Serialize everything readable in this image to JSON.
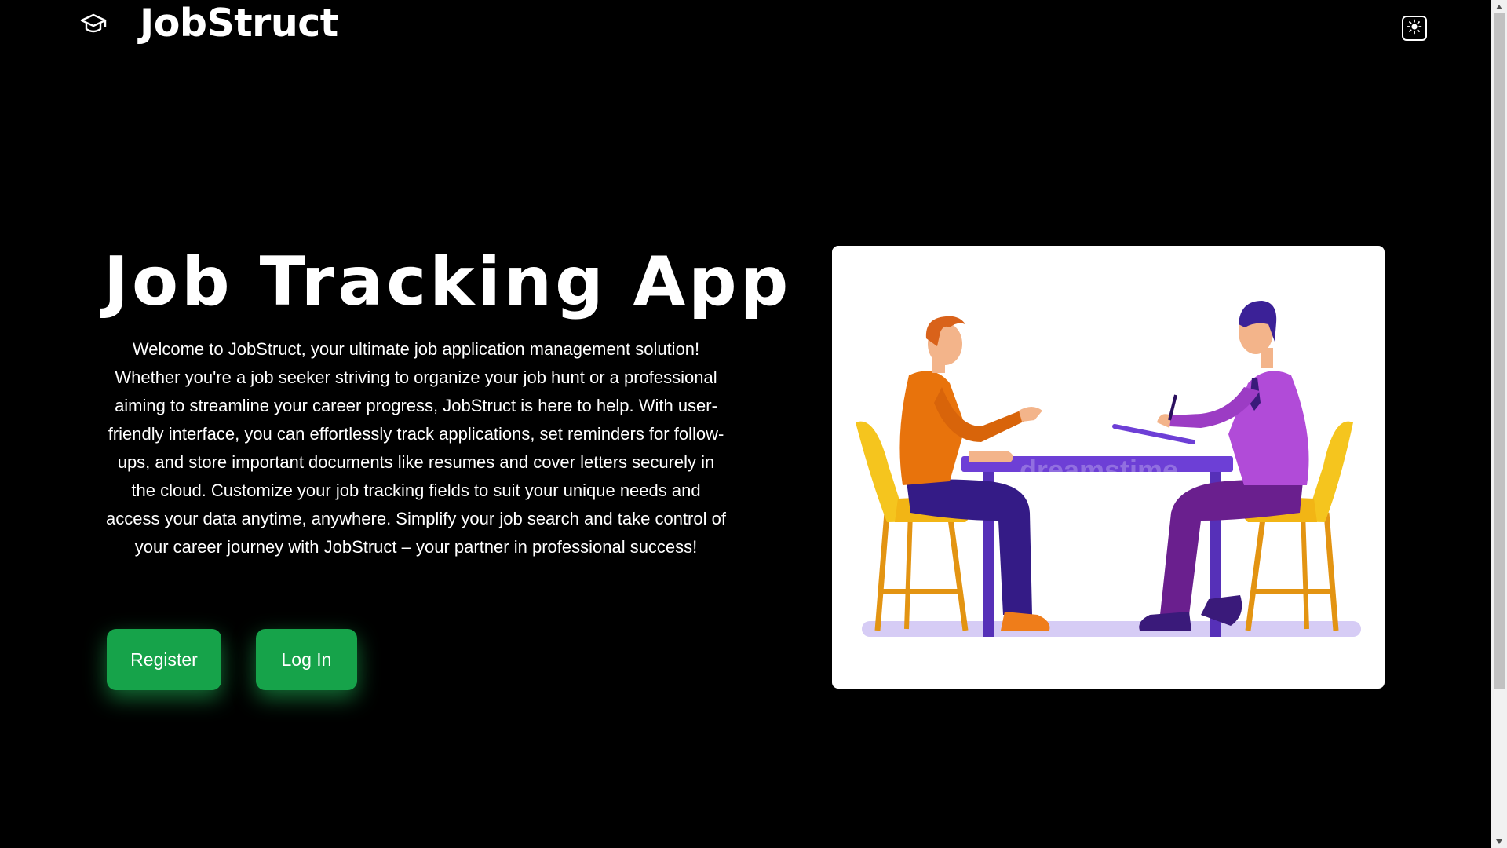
{
  "header": {
    "brand_name": "JobStruct",
    "logo_icon": "graduation-cap-icon",
    "theme_toggle_icon": "sun-icon"
  },
  "hero": {
    "title": "Job Tracking App",
    "description": "Welcome to JobStruct, your ultimate job application management solution! Whether you're a job seeker striving to organize your job hunt or a professional aiming to streamline your career progress, JobStruct is here to help. With user-friendly interface, you can effortlessly track applications, set reminders for follow-ups, and store important documents like resumes and cover letters securely in the cloud. Customize your job tracking fields to suit your unique needs and access your data anytime, anywhere. Simplify your job search and take control of your career journey with JobStruct – your partner in professional success!",
    "register_label": "Register",
    "login_label": "Log In"
  },
  "illustration": {
    "subject": "two-people-interview-at-table",
    "watermark": "dreamstime"
  },
  "colors": {
    "background": "#000000",
    "button": "#16a34a",
    "button_glow": "#22c55e",
    "card": "#ffffff",
    "table": "#6d3fd6",
    "chair": "#f5b81c",
    "candidate_shirt": "#e8730c",
    "interviewer_shirt": "#b14bd8"
  }
}
